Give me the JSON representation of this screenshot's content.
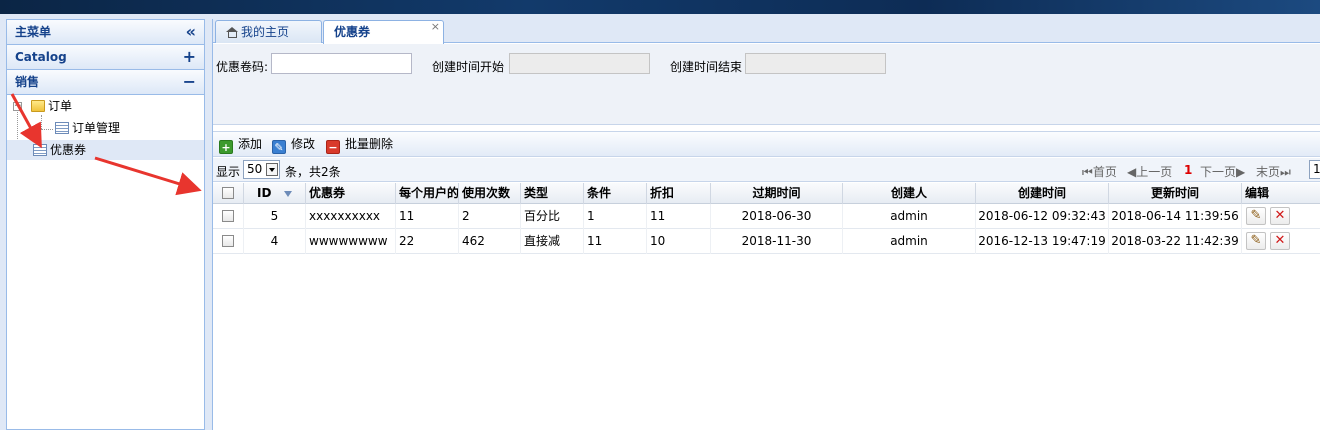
{
  "left_panel": {
    "main_menu": "主菜单",
    "collapse_glyph": "«",
    "sections": [
      {
        "label": "Catalog",
        "tool": "+"
      },
      {
        "label": "销售",
        "tool": "−"
      }
    ],
    "tree": {
      "order_folder": "订单",
      "order_management": "订单管理",
      "coupon": "优惠券"
    }
  },
  "tabs": [
    {
      "label": "我的主页"
    },
    {
      "label": "优惠券",
      "close": "×"
    }
  ],
  "search": {
    "code_label": "优惠卷码:",
    "start_label": "创建时间开始",
    "end_label": "创建时间结束"
  },
  "toolbar": {
    "add": "添加",
    "edit": "修改",
    "batch_delete": "批量删除"
  },
  "pager": {
    "show_label": "显示",
    "page_size": "50",
    "count_text": "条，共2条",
    "first": "首页",
    "prev": "上一页",
    "current": "1",
    "next": "下一页",
    "last": "末页",
    "page_input": "1"
  },
  "table": {
    "columns": [
      "ID",
      "优惠券",
      "每个用户的",
      "使用次数",
      "类型",
      "条件",
      "折扣",
      "过期时间",
      "创建人",
      "创建时间",
      "更新时间",
      "编辑"
    ],
    "rows": [
      [
        "5",
        "xxxxxxxxxx",
        "11",
        "2",
        "百分比",
        "1",
        "11",
        "2018-06-30",
        "admin",
        "2018-06-12 09:32:43",
        "2018-06-14 11:39:56"
      ],
      [
        "4",
        "wwwwwwww",
        "22",
        "462",
        "直接减",
        "11",
        "10",
        "2018-11-30",
        "admin",
        "2016-12-13 19:47:19",
        "2018-03-22 11:42:39"
      ]
    ]
  },
  "colors": {
    "header_text": "#15428b",
    "border": "#99bbe8",
    "arrow": "#e8352e"
  }
}
